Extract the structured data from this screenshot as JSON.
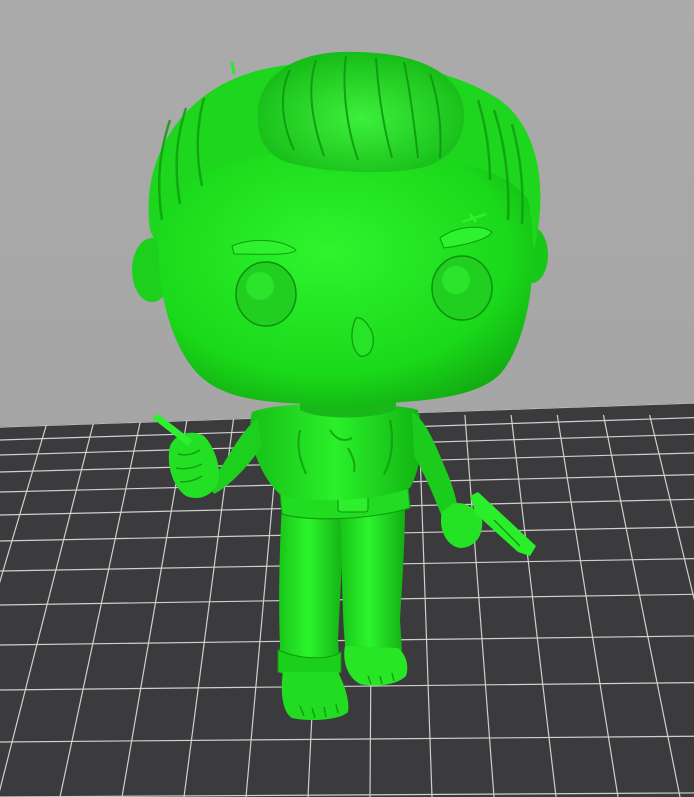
{
  "viewport": {
    "colors": {
      "background_top": "#a9a9a9",
      "background_bottom": "#a2a2a2",
      "bed": "#3b3b3d",
      "grid_lines": "#cfcfcf",
      "model_base": "#1ee21e",
      "model_highlight": "#4dff4d",
      "model_shadow": "#0f8f0f"
    },
    "model": {
      "name_icon": "figurine-model",
      "type": "3d-printable figurine"
    }
  }
}
